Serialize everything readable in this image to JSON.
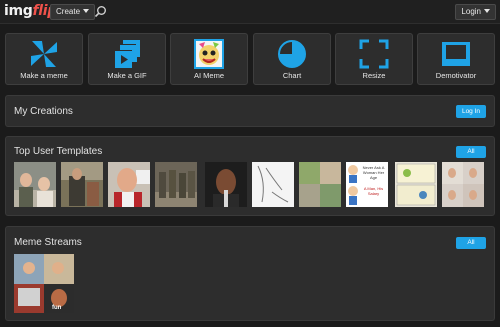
{
  "header": {
    "logo_part1": "img",
    "logo_part2": "flip",
    "create_label": "Create",
    "login_label": "Login"
  },
  "tools": [
    {
      "label": "Make a meme",
      "icon": "pinwheel-icon"
    },
    {
      "label": "Make a GIF",
      "icon": "film-stack-icon"
    },
    {
      "label": "AI Meme",
      "icon": "ai-face-icon"
    },
    {
      "label": "Chart",
      "icon": "pie-chart-icon"
    },
    {
      "label": "Resize",
      "icon": "resize-corners-icon"
    },
    {
      "label": "Demotivator",
      "icon": "frame-icon"
    }
  ],
  "my_creations": {
    "title": "My Creations",
    "login_label": "Log In"
  },
  "top_templates": {
    "title": "Top User Templates",
    "all_label": "All",
    "thumb5_text_a": "Never Ask A Woman Her Age",
    "thumb5_text_b": "A Man, His Salary"
  },
  "meme_streams": {
    "title": "Meme Streams",
    "all_label": "All",
    "thumb_text": "fun"
  },
  "colors": {
    "accent": "#1fa3e6",
    "logo_red": "#f0524b",
    "panel_bg": "#2d2d2d",
    "page_bg": "#1b1b1b"
  }
}
